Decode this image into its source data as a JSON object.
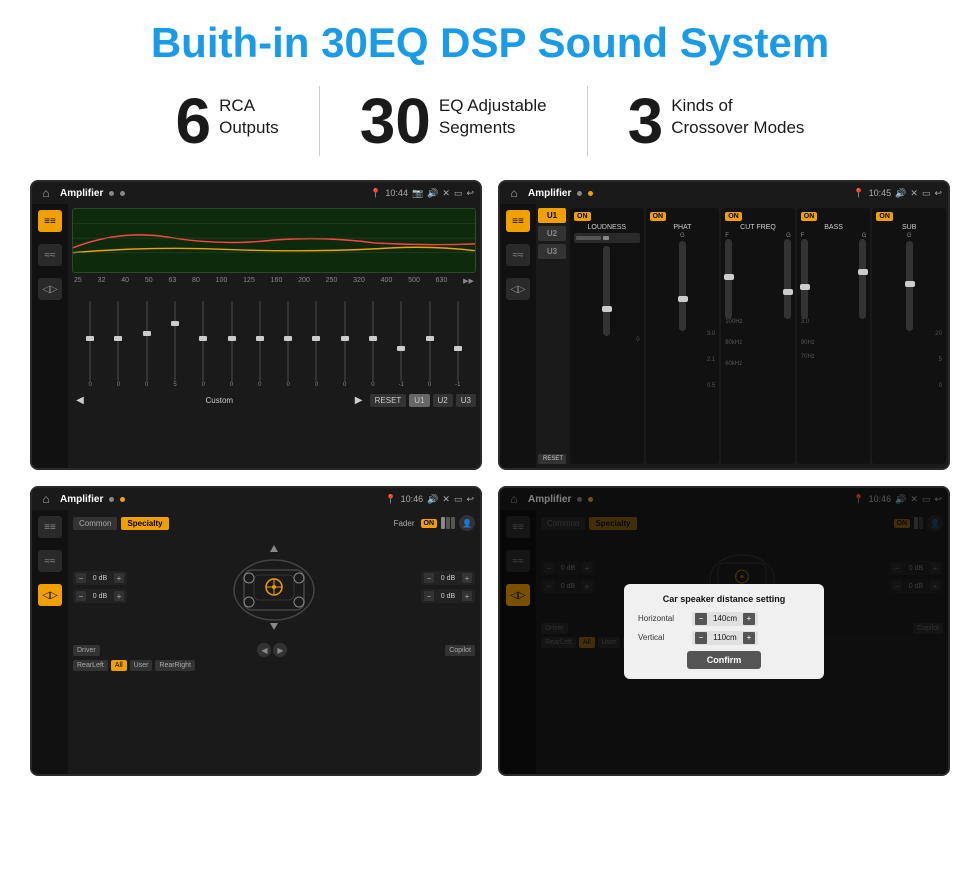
{
  "title": "Buith-in 30EQ DSP Sound System",
  "stats": [
    {
      "number": "6",
      "label": "RCA\nOutputs"
    },
    {
      "number": "30",
      "label": "EQ Adjustable\nSegments"
    },
    {
      "number": "3",
      "label": "Kinds of\nCrossover Modes"
    }
  ],
  "screenshots": [
    {
      "id": "eq-screen",
      "status_title": "Amplifier",
      "time": "10:44",
      "description": "30-band EQ with custom profile"
    },
    {
      "id": "crossover-screen",
      "status_title": "Amplifier",
      "time": "10:45",
      "description": "3 crossover modes with presets"
    },
    {
      "id": "fader-screen",
      "status_title": "Amplifier",
      "time": "10:46",
      "description": "Fader and speaker layout"
    },
    {
      "id": "distance-screen",
      "status_title": "Amplifier",
      "time": "10:46",
      "description": "Car speaker distance setting dialog",
      "dialog": {
        "title": "Car speaker distance setting",
        "horizontal_label": "Horizontal",
        "horizontal_value": "140cm",
        "vertical_label": "Vertical",
        "vertical_value": "110cm",
        "confirm_label": "Confirm"
      }
    }
  ],
  "eq_frequencies": [
    "25",
    "32",
    "40",
    "50",
    "63",
    "80",
    "100",
    "125",
    "160",
    "200",
    "250",
    "320",
    "400",
    "500",
    "630"
  ],
  "eq_values": [
    "0",
    "0",
    "0",
    "5",
    "0",
    "0",
    "0",
    "0",
    "0",
    "0",
    "0",
    "-1",
    "0",
    "-1"
  ],
  "eq_preset": "Custom",
  "eq_buttons": [
    "RESET",
    "U1",
    "U2",
    "U3"
  ],
  "crossover_presets": [
    "U1",
    "U2",
    "U3"
  ],
  "crossover_panels": [
    {
      "name": "LOUDNESS",
      "on": true
    },
    {
      "name": "PHAT",
      "on": true
    },
    {
      "name": "CUT FREQ",
      "on": true
    },
    {
      "name": "BASS",
      "on": true
    },
    {
      "name": "SUB",
      "on": true
    }
  ],
  "fader_tabs": [
    "Common",
    "Specialty"
  ],
  "fader_label": "Fader",
  "fader_on": "ON",
  "speaker_db_controls": [
    {
      "label": "0 dB"
    },
    {
      "label": "0 dB"
    },
    {
      "label": "0 dB"
    },
    {
      "label": "0 dB"
    }
  ],
  "speaker_buttons": [
    "Driver",
    "RearLeft",
    "All",
    "User",
    "RearRight",
    "Copilot"
  ]
}
